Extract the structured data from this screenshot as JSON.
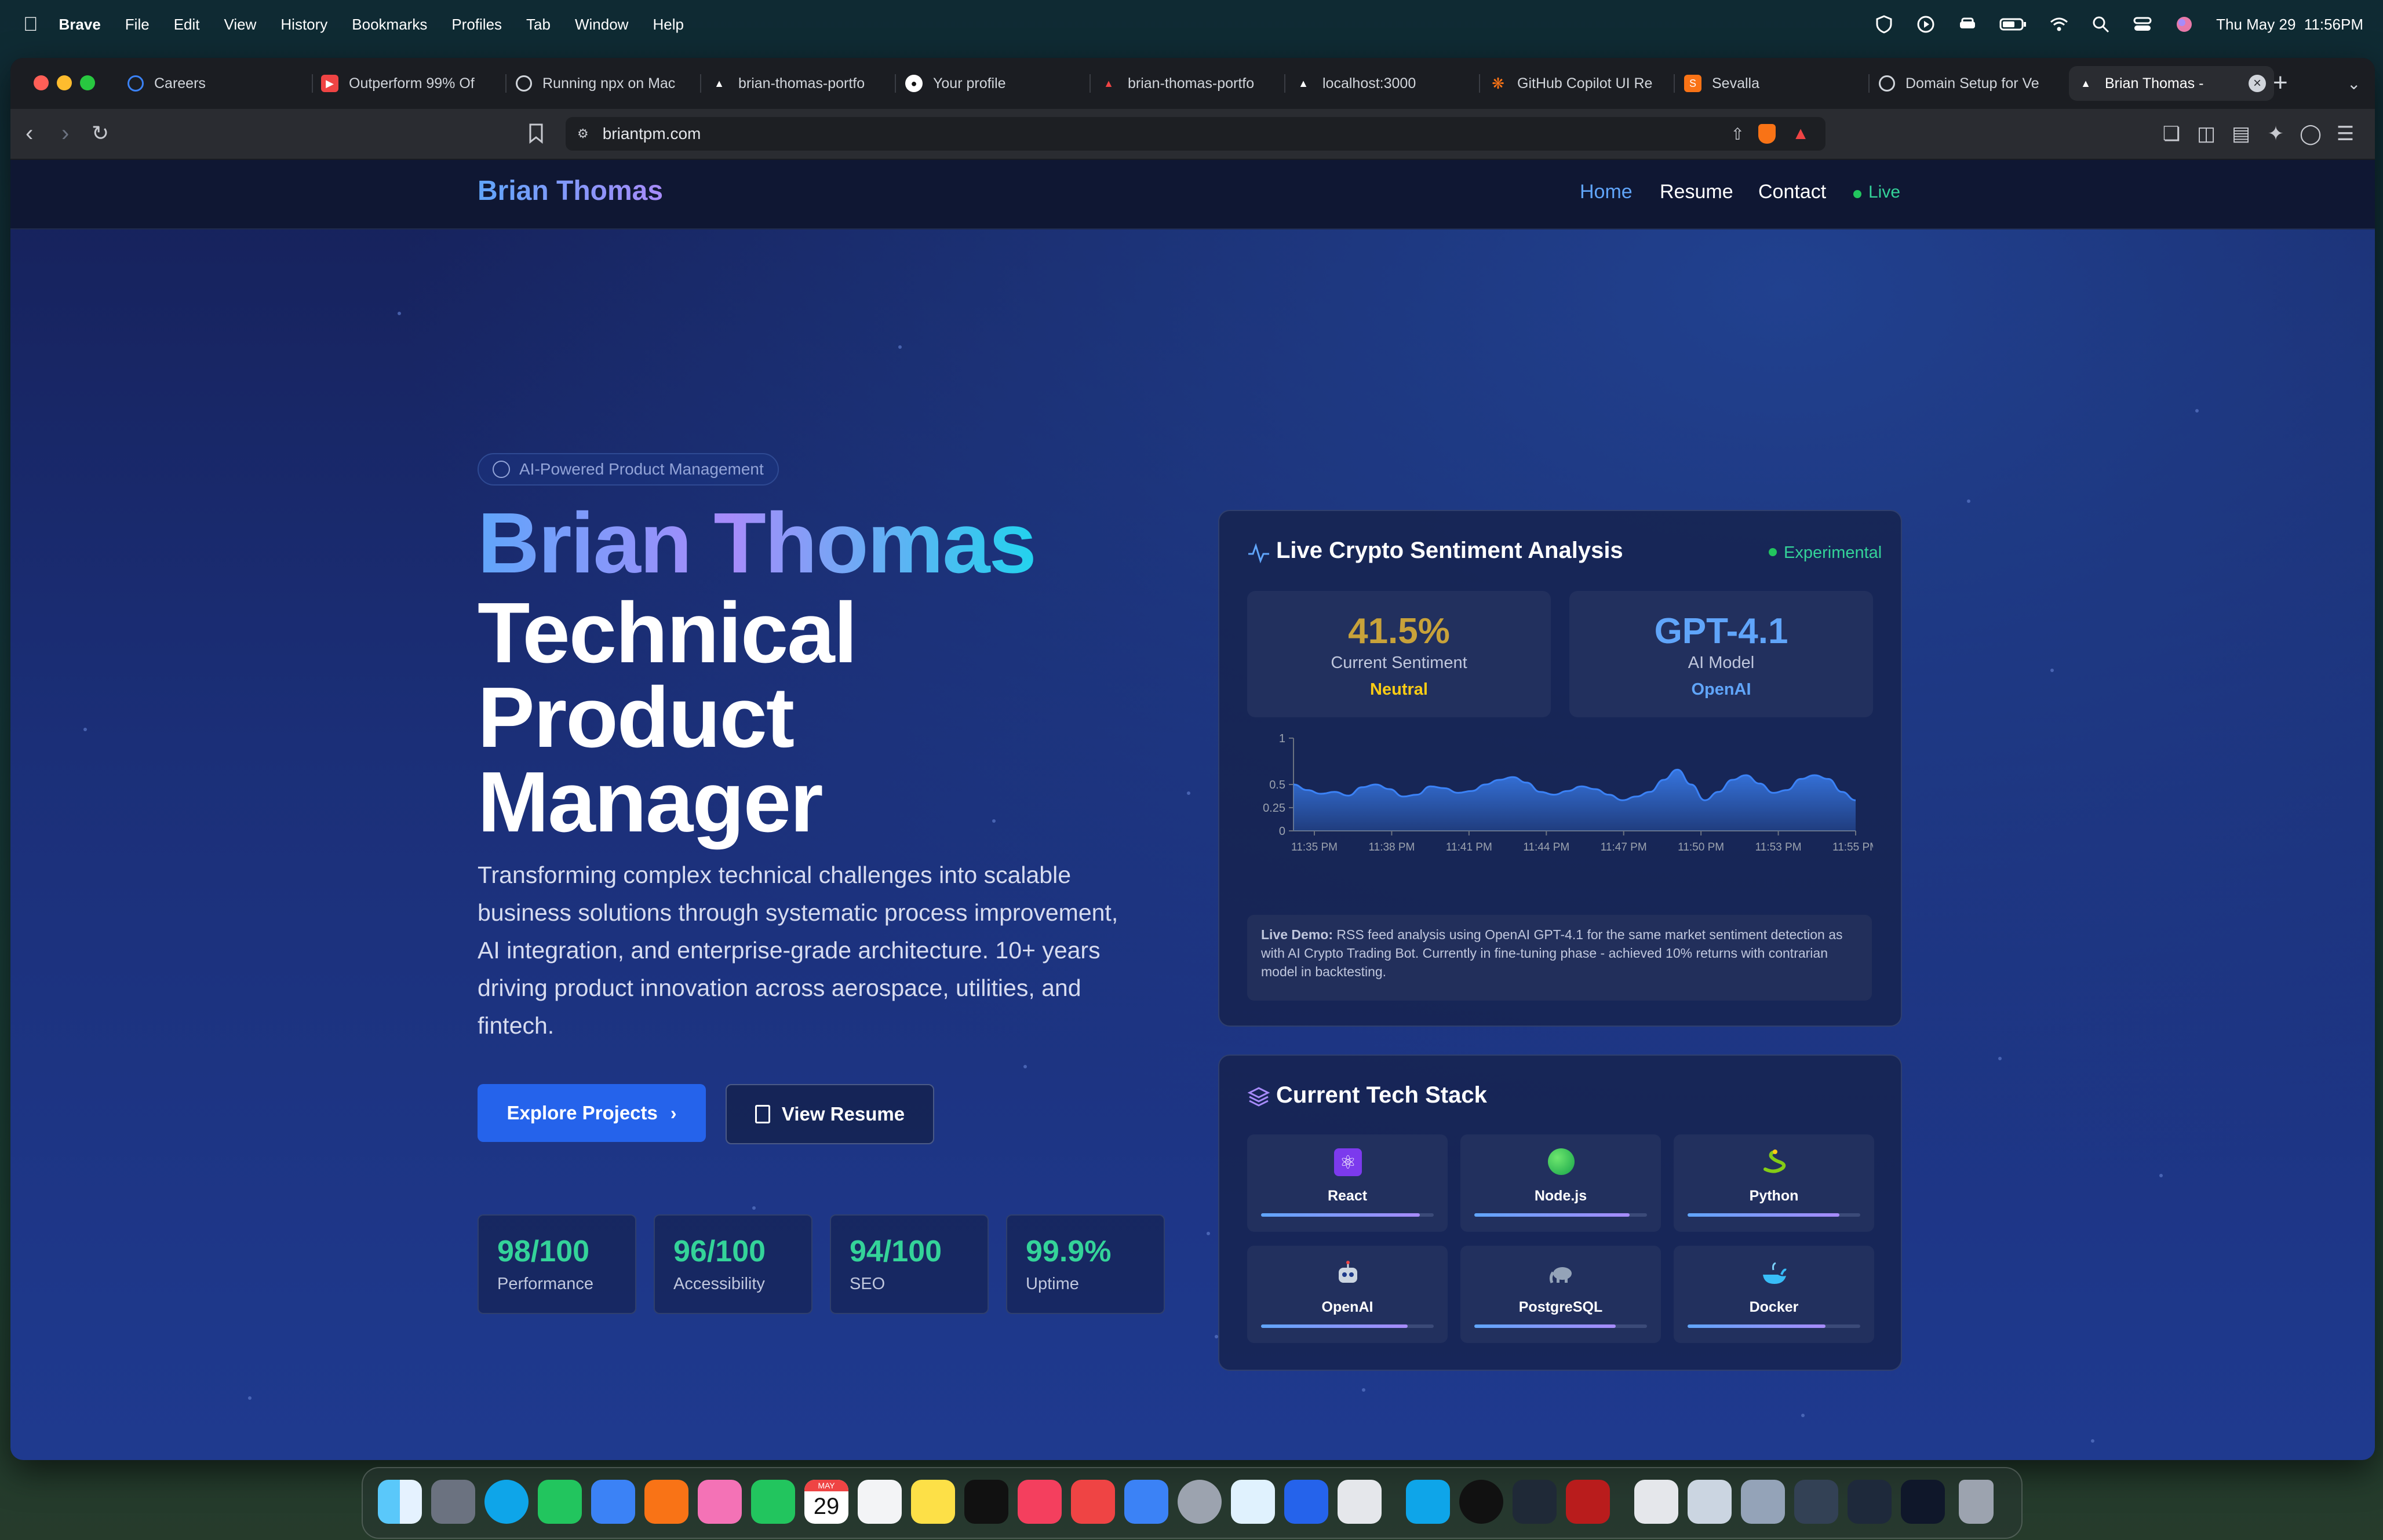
{
  "menubar": {
    "app": "Brave",
    "items": [
      "File",
      "Edit",
      "View",
      "History",
      "Bookmarks",
      "Profiles",
      "Tab",
      "Window",
      "Help"
    ],
    "datetime": "Thu May 29  11:56PM"
  },
  "browser": {
    "tabs": [
      {
        "label": "Careers",
        "icon": "careers-favicon",
        "color": "#3b82f6"
      },
      {
        "label": "Outperform 99% Of",
        "icon": "youtube-favicon",
        "color": "#ef4444"
      },
      {
        "label": "Running npx on Mac",
        "icon": "chatgpt-favicon",
        "color": "#9ca3af"
      },
      {
        "label": "brian-thomas-portfo",
        "icon": "vercel-favicon",
        "color": "#ffffff"
      },
      {
        "label": "Your profile",
        "icon": "github-favicon",
        "color": "#ffffff"
      },
      {
        "label": "brian-thomas-portfo",
        "icon": "vercel-favicon",
        "color": "#ef4444"
      },
      {
        "label": "localhost:3000",
        "icon": "vercel-favicon",
        "color": "#ffffff"
      },
      {
        "label": "GitHub Copilot UI Re",
        "icon": "claude-favicon",
        "color": "#f97316"
      },
      {
        "label": "Sevalla",
        "icon": "sevalla-favicon",
        "color": "#f97316"
      },
      {
        "label": "Domain Setup for Ve",
        "icon": "chatgpt-favicon",
        "color": "#9ca3af"
      },
      {
        "label": "Brian Thomas -",
        "icon": "vercel-favicon",
        "color": "#ffffff"
      }
    ],
    "url": "briantpm.com"
  },
  "site": {
    "brand": "Brian Thomas",
    "nav": {
      "home": "Home",
      "resume": "Resume",
      "contact": "Contact",
      "live": "Live"
    },
    "badge": "AI-Powered Product Management",
    "hero_name": "Brian Thomas",
    "hero_title_lines": [
      "Technical",
      "Product",
      "Manager"
    ],
    "description": "Transforming complex technical challenges into scalable business solutions through systematic process improvement, AI integration, and enterprise-grade architecture. 10+ years driving product innovation across aerospace, utilities, and fintech.",
    "cta_primary": "Explore Projects",
    "cta_secondary": "View Resume",
    "metrics": [
      {
        "value": "98/100",
        "label": "Performance"
      },
      {
        "value": "96/100",
        "label": "Accessibility"
      },
      {
        "value": "94/100",
        "label": "SEO"
      },
      {
        "value": "99.9%",
        "label": "Uptime"
      }
    ]
  },
  "sentiment_card": {
    "title": "Live Crypto Sentiment Analysis",
    "status": "Experimental",
    "sentiment_value": "41.5%",
    "sentiment_label": "Current Sentiment",
    "sentiment_state": "Neutral",
    "model_value": "GPT-4.1",
    "model_label": "AI Model",
    "model_vendor": "OpenAI",
    "demo_label": "Live Demo:",
    "demo_text": " RSS feed analysis using OpenAI GPT-4.1 for the same market sentiment detection as with AI Crypto Trading Bot. Currently in fine-tuning phase - achieved 10% returns with contrarian model in backtesting.",
    "colors": {
      "sentiment": "#c8a23a",
      "neutral": "#facc15",
      "model": "#60a5fa"
    }
  },
  "chart_data": {
    "type": "area",
    "x_ticks": [
      "11:35 PM",
      "11:38 PM",
      "11:41 PM",
      "11:44 PM",
      "11:47 PM",
      "11:50 PM",
      "11:53 PM",
      "11:55 PM"
    ],
    "y_ticks": [
      "0",
      "0.25",
      "0.5",
      "1"
    ],
    "ylim": [
      0,
      1
    ],
    "values": [
      0.5,
      0.44,
      0.4,
      0.42,
      0.38,
      0.47,
      0.5,
      0.45,
      0.37,
      0.39,
      0.48,
      0.46,
      0.41,
      0.43,
      0.5,
      0.55,
      0.58,
      0.52,
      0.42,
      0.39,
      0.43,
      0.48,
      0.45,
      0.39,
      0.33,
      0.37,
      0.42,
      0.55,
      0.66,
      0.5,
      0.33,
      0.42,
      0.55,
      0.6,
      0.51,
      0.41,
      0.44,
      0.56,
      0.6,
      0.56,
      0.42,
      0.33
    ],
    "color": "#3b82f6",
    "grid": false
  },
  "tech_card": {
    "title": "Current Tech Stack",
    "items": [
      {
        "name": "React",
        "icon": "atom-icon",
        "level": 0.92
      },
      {
        "name": "Node.js",
        "icon": "green-circle-icon",
        "level": 0.9
      },
      {
        "name": "Python",
        "icon": "snake-icon",
        "level": 0.88
      },
      {
        "name": "OpenAI",
        "icon": "robot-icon",
        "level": 0.85
      },
      {
        "name": "PostgreSQL",
        "icon": "elephant-icon",
        "level": 0.82
      },
      {
        "name": "Docker",
        "icon": "whale-icon",
        "level": 0.8
      }
    ]
  },
  "dock": {
    "calendar_month": "MAY",
    "calendar_day": "29",
    "apps": [
      "Finder",
      "Launchpad",
      "Safari",
      "Messages",
      "Mail",
      "Brave",
      "Photos",
      "FaceTime",
      "Calendar",
      "Reminders",
      "Notes",
      "TV",
      "Music",
      "News",
      "App Store",
      "System Settings",
      "Keychain",
      "Word",
      "Preview",
      "VS Code",
      "GitHub Desktop",
      "Terminal",
      "Dictionary",
      "Documents",
      "Windows",
      "Trash"
    ]
  }
}
